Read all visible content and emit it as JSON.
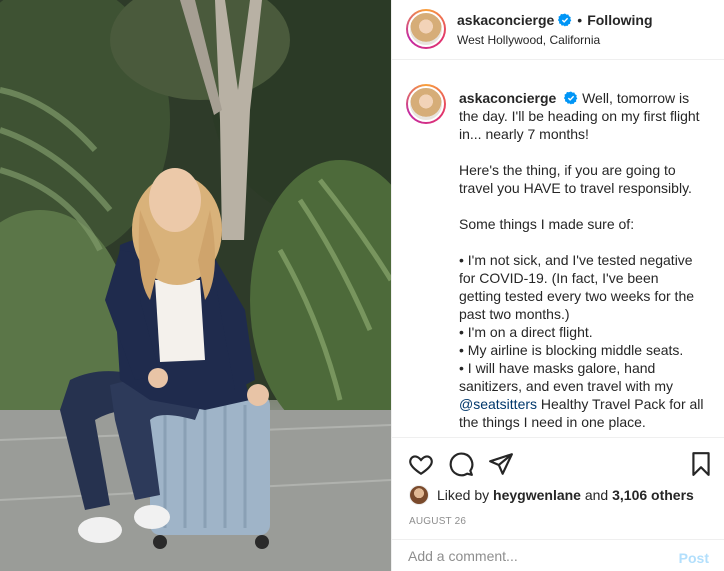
{
  "post": {
    "username": "askaconcierge",
    "verified": true,
    "follow_separator": "•",
    "follow_status": "Following",
    "location": "West Hollywood, California",
    "caption": {
      "intro": "Well, tomorrow is the day. I'll be heading on my first flight in... nearly 7 months!",
      "paragraph2": "Here's the thing, if you are going to travel you HAVE to travel responsibly.",
      "paragraph3": "Some things I made sure of:",
      "bullet1": "• I'm not sick, and I've tested negative for COVID-19. (In fact, I've been getting tested every two weeks for the past two months.)",
      "bullet2": "• I'm on a direct flight.",
      "bullet3": "• My airline is blocking middle seats.",
      "bullet4_before": "• I will have masks galore, hand sanitizers, and even travel with my ",
      "bullet4_mention": "@seatsitters",
      "bullet4_after": " Healthy Travel Pack for all the things I need in one place."
    },
    "likes": {
      "prefix": "Liked by ",
      "first_user": "heygwenlane",
      "middle": " and ",
      "others": "3,106 others"
    },
    "date": "AUGUST 26",
    "comment": {
      "placeholder": "Add a comment...",
      "post_label": "Post"
    },
    "icons": {
      "like": "heart-icon",
      "comment": "comment-icon",
      "share": "paper-plane-icon",
      "save": "bookmark-icon",
      "verified": "verified-badge-icon"
    },
    "colors": {
      "verified_blue": "#0095f6",
      "mention": "#00376b",
      "post_disabled": "#b2dffc",
      "muted": "#8e8e8e"
    }
  }
}
